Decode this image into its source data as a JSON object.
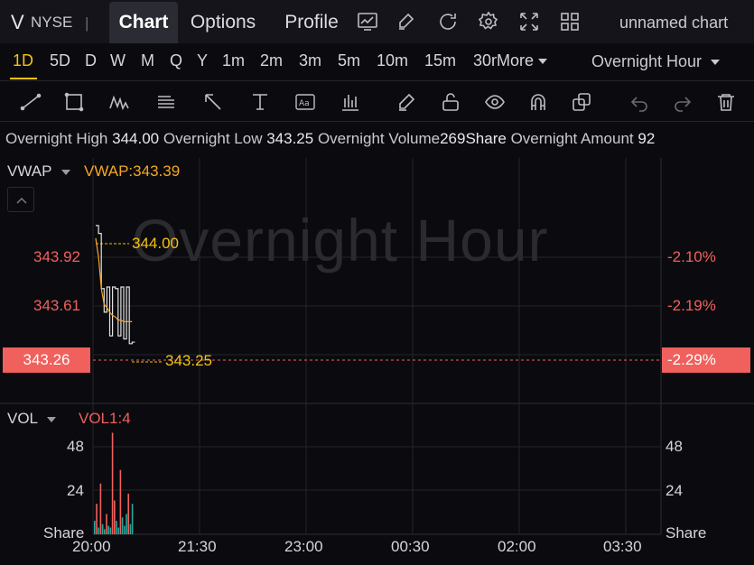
{
  "topbar": {
    "symbol": "V",
    "exchange": "NYSE",
    "separator": "|",
    "tabs": [
      {
        "label": "Chart",
        "active": true
      },
      {
        "label": "Options",
        "active": false
      },
      {
        "label": "Profile",
        "active": false
      }
    ],
    "icons": [
      "chart-type-icon",
      "edit-icon",
      "refresh-icon",
      "settings-icon",
      "fullscreen-icon",
      "layout-grid-icon"
    ],
    "chart_name": "unnamed chart"
  },
  "intervals": {
    "items": [
      "1D",
      "5D",
      "D",
      "W",
      "M",
      "Q",
      "Y",
      "1m",
      "2m",
      "3m",
      "5m",
      "10m",
      "15m",
      "30m"
    ],
    "selected": "1D",
    "more_label": "More",
    "session_label": "Overnight Hour"
  },
  "toolbar": {
    "tools": [
      "trend-line-icon",
      "rectangle-icon",
      "pattern-icon",
      "fib-icon",
      "arrow-icon",
      "measure-icon",
      "text-icon",
      "indicators-icon",
      "brush-icon",
      "lock-icon",
      "eye-icon",
      "magnet-icon",
      "duplicate-icon",
      "undo-icon",
      "redo-icon",
      "trash-icon"
    ]
  },
  "infoline": {
    "high_label": "Overnight High",
    "high_value": "344.00",
    "low_label": "Overnight Low",
    "low_value": "343.25",
    "volume_label": "Overnight Volume",
    "volume_value": "269Share",
    "amount_label": "Overnight Amount",
    "amount_value": "92"
  },
  "price_pane": {
    "indicator_name": "VWAP",
    "indicator_value": "VWAP:343.39",
    "watermark": "Overnight Hour",
    "y_labels_left": [
      "343.92",
      "343.61"
    ],
    "y_labels_right": [
      "-2.10%",
      "-2.19%"
    ],
    "current_price": "343.26",
    "current_change": "-2.29%",
    "high_marker": "344.00",
    "low_marker": "343.25"
  },
  "volume_pane": {
    "indicator_name": "VOL",
    "indicator_value": "VOL1:4",
    "y_labels": [
      "48",
      "24"
    ],
    "unit": "Share"
  },
  "x_axis": {
    "labels": [
      "20:00",
      "21:30",
      "23:00",
      "00:30",
      "02:00",
      "03:30"
    ]
  },
  "colors": {
    "up": "#26a69a",
    "down": "#f0605d",
    "accent": "#f4c20d",
    "vwap": "#f5a623",
    "price_line": "#e0e0e0"
  },
  "chart_data": {
    "type": "line",
    "price_series": [
      344.0,
      343.95,
      343.6,
      343.45,
      343.61,
      343.3,
      343.61,
      343.6,
      343.3,
      343.61,
      343.28,
      343.61,
      343.25,
      343.26
    ],
    "vwap_series": [
      343.92,
      343.8,
      343.6,
      343.5,
      343.48,
      343.45,
      343.43,
      343.42,
      343.4,
      343.4,
      343.39,
      343.39,
      343.39,
      343.39
    ],
    "volume": [
      {
        "v": 8,
        "dir": "up"
      },
      {
        "v": 18,
        "dir": "down"
      },
      {
        "v": 4,
        "dir": "up"
      },
      {
        "v": 30,
        "dir": "down"
      },
      {
        "v": 6,
        "dir": "up"
      },
      {
        "v": 3,
        "dir": "up"
      },
      {
        "v": 12,
        "dir": "down"
      },
      {
        "v": 5,
        "dir": "up"
      },
      {
        "v": 4,
        "dir": "up"
      },
      {
        "v": 60,
        "dir": "down"
      },
      {
        "v": 20,
        "dir": "down"
      },
      {
        "v": 8,
        "dir": "up"
      },
      {
        "v": 4,
        "dir": "up"
      },
      {
        "v": 38,
        "dir": "down"
      },
      {
        "v": 10,
        "dir": "up"
      },
      {
        "v": 5,
        "dir": "up"
      },
      {
        "v": 12,
        "dir": "up"
      },
      {
        "v": 24,
        "dir": "down"
      },
      {
        "v": 6,
        "dir": "up"
      },
      {
        "v": 18,
        "dir": "up"
      }
    ],
    "price_range": [
      343.1,
      344.2
    ],
    "volume_range": [
      0,
      72
    ]
  }
}
